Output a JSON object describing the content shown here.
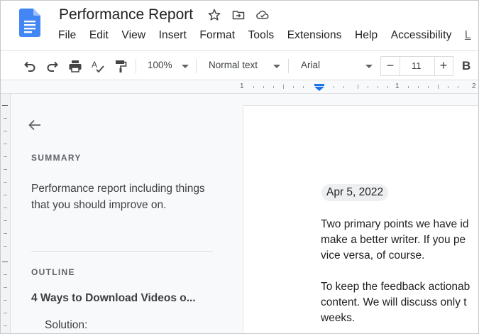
{
  "document": {
    "title": "Performance Report"
  },
  "menu": [
    "File",
    "Edit",
    "View",
    "Insert",
    "Format",
    "Tools",
    "Extensions",
    "Help",
    "Accessibility",
    "L"
  ],
  "toolbar": {
    "zoom": "100%",
    "style": "Normal text",
    "font": "Arial",
    "font_size": "11",
    "minus_label": "−",
    "plus_label": "+",
    "bold_label": "B"
  },
  "ruler": {
    "labels": [
      "1",
      "1",
      "2"
    ]
  },
  "outline_panel": {
    "summary_heading": "SUMMARY",
    "summary_text": "Performance report including things that you should improve on.",
    "outline_heading": "OUTLINE",
    "items": [
      "4 Ways to Download Videos o..."
    ],
    "sub_items": [
      "Solution:"
    ]
  },
  "page": {
    "date_chip": "Apr 5, 2022",
    "paragraph1": [
      "Two primary points we have id",
      "make a better writer. If you pe",
      "vice versa, of course."
    ],
    "paragraph2": [
      "To keep the feedback actionab",
      "content. We will discuss only t",
      "weeks."
    ]
  },
  "colors": {
    "docs_blue": "#4285f4",
    "docs_blue_dark": "#3367d6",
    "ruler_marker": "#1a73e8"
  }
}
